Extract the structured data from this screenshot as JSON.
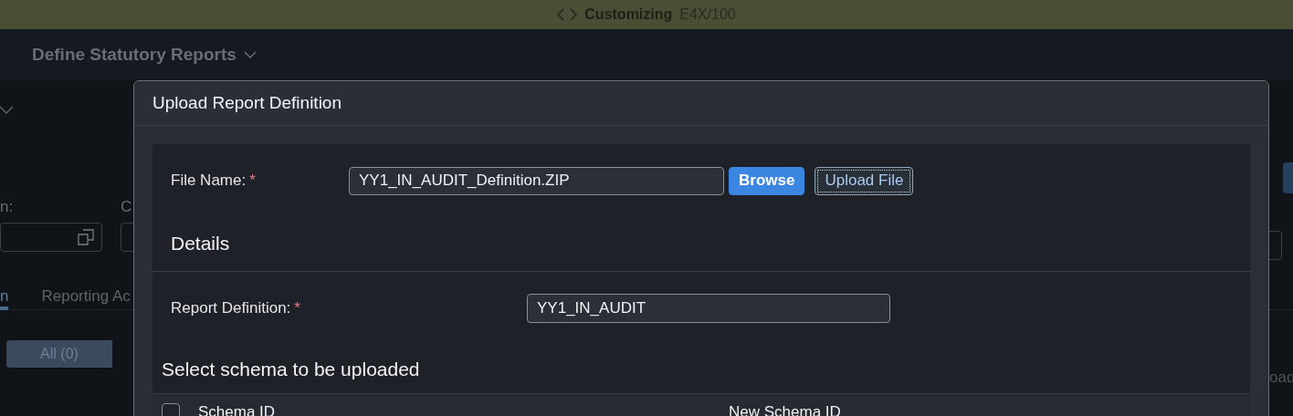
{
  "shell_bar": {
    "title": "Customizing",
    "system": "E4X/100"
  },
  "app_header": {
    "title": "Define Statutory Reports"
  },
  "background": {
    "label_1": "n:",
    "label_2": "C",
    "tabs": [
      {
        "label": "n",
        "selected": true
      },
      {
        "label": "Reporting Ac",
        "selected": false
      }
    ],
    "segments": [
      {
        "label": "All (0)",
        "selected": true
      }
    ],
    "right_text": "oad"
  },
  "dialog": {
    "title": "Upload Report Definition",
    "file_field": {
      "label": "File Name:",
      "required_mark": "*",
      "value": "YY1_IN_AUDIT_Definition.ZIP"
    },
    "buttons": [
      {
        "label": "Browse",
        "kind": "primary"
      },
      {
        "label": "Upload File",
        "kind": "focused"
      }
    ],
    "details_title": "Details",
    "report_field": {
      "label": "Report Definition:",
      "required_mark": "*",
      "value": "YY1_IN_AUDIT"
    },
    "schema_title": "Select schema to be uploaded",
    "table": {
      "select_all_checked": false,
      "columns": [
        "Schema ID",
        "New Schema ID"
      ]
    }
  }
}
